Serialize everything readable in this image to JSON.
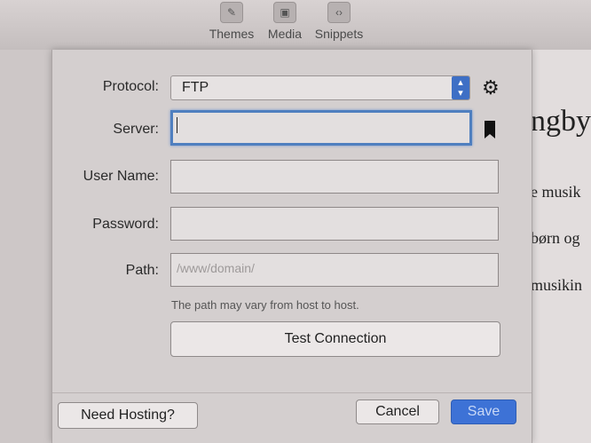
{
  "toolbar": {
    "themes_label": "Themes",
    "media_label": "Media",
    "snippets_label": "Snippets"
  },
  "document": {
    "line1": "ngby",
    "line2": "e musik",
    "line3": "børn og",
    "line4": "musikin"
  },
  "form": {
    "protocol_label": "Protocol:",
    "protocol_value": "FTP",
    "server_label": "Server:",
    "server_value": "",
    "username_label": "User Name:",
    "username_value": "",
    "password_label": "Password:",
    "password_value": "",
    "path_label": "Path:",
    "path_placeholder": "/www/domain/",
    "path_hint": "The path may vary from host to host.",
    "test_connection": "Test Connection"
  },
  "footer": {
    "need_hosting": "Need Hosting?",
    "cancel": "Cancel",
    "save": "Save"
  },
  "colors": {
    "accent": "#3d72d6",
    "focus_ring": "#4f7fbf"
  }
}
